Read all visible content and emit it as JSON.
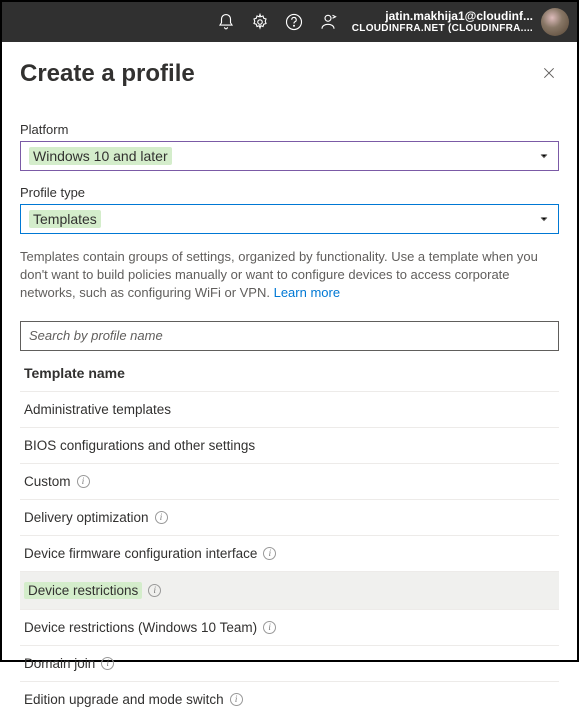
{
  "topbar": {
    "user_email": "jatin.makhija1@cloudinf...",
    "user_org": "CLOUDINFRA.NET (CLOUDINFRA...."
  },
  "panel": {
    "title": "Create a profile"
  },
  "platform": {
    "label": "Platform",
    "value": "Windows 10 and later"
  },
  "profile_type": {
    "label": "Profile type",
    "value": "Templates"
  },
  "description": {
    "text": "Templates contain groups of settings, organized by functionality. Use a template when you don't want to build policies manually or want to configure devices to access corporate networks, such as configuring WiFi or VPN. ",
    "link": "Learn more"
  },
  "search": {
    "placeholder": "Search by profile name"
  },
  "list": {
    "header": "Template name",
    "items": [
      {
        "label": "Administrative templates",
        "info": false
      },
      {
        "label": "BIOS configurations and other settings",
        "info": false
      },
      {
        "label": "Custom",
        "info": true
      },
      {
        "label": "Delivery optimization",
        "info": true
      },
      {
        "label": "Device firmware configuration interface",
        "info": true
      },
      {
        "label": "Device restrictions",
        "info": true,
        "highlight": true
      },
      {
        "label": "Device restrictions (Windows 10 Team)",
        "info": true
      },
      {
        "label": "Domain join",
        "info": true
      },
      {
        "label": "Edition upgrade and mode switch",
        "info": true
      }
    ]
  }
}
